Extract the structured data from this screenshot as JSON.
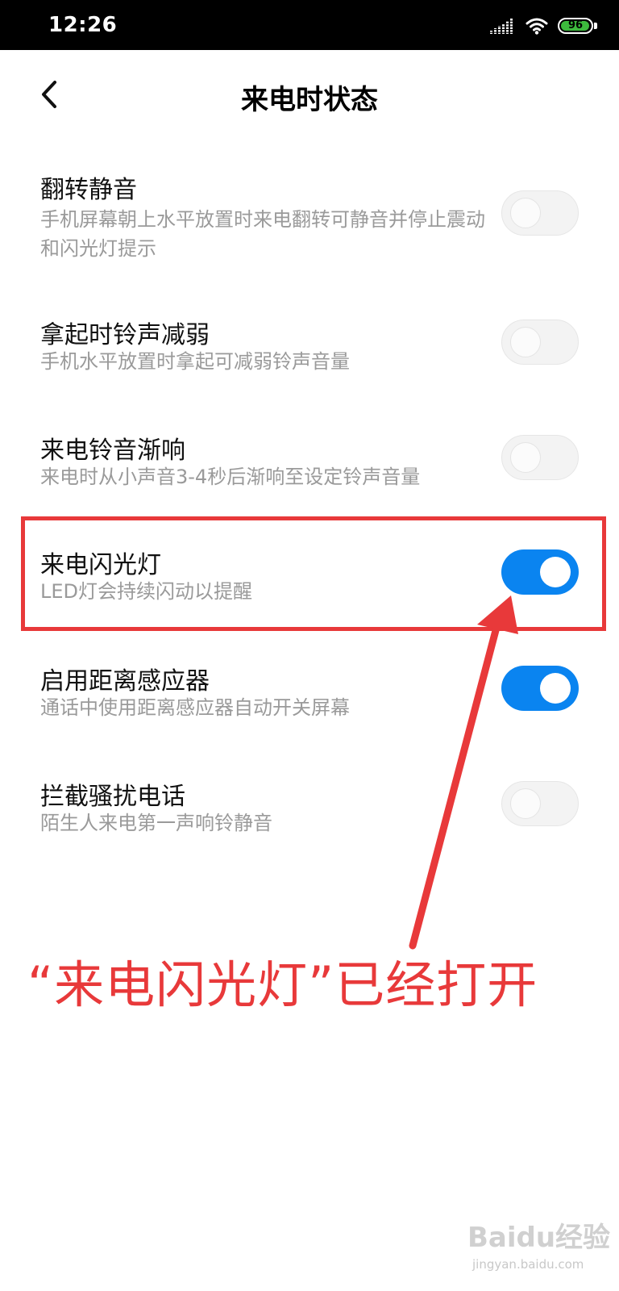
{
  "status_bar": {
    "time": "12:26",
    "signal_icon": "cellular-signal-icon",
    "wifi_icon": "wifi-icon",
    "battery_level": "96",
    "battery_color": "#3dba3d"
  },
  "header": {
    "back_icon": "chevron-left-icon",
    "title": "来电时状态"
  },
  "settings": [
    {
      "title": "翻转静音",
      "description": "手机屏幕朝上水平放置时来电翻转可静音并停止震动和闪光灯提示",
      "enabled": false
    },
    {
      "title": "拿起时铃声减弱",
      "description": "手机水平放置时拿起可减弱铃声音量",
      "enabled": false
    },
    {
      "title": "来电铃音渐响",
      "description": "来电时从小声音3-4秒后渐响至设定铃声音量",
      "enabled": false
    },
    {
      "title": "来电闪光灯",
      "description": "LED灯会持续闪动以提醒",
      "enabled": true
    },
    {
      "title": "启用距离感应器",
      "description": "通话中使用距离感应器自动开关屏幕",
      "enabled": true
    },
    {
      "title": "拦截骚扰电话",
      "description": "陌生人来电第一声响铃静音",
      "enabled": false
    }
  ],
  "colors": {
    "toggle_on": "#0a84f0",
    "annotation": "#e8393a"
  },
  "annotation": {
    "text": "“来电闪光灯”已经打开"
  },
  "watermark": {
    "logo": "Baidu经验",
    "url": "jingyan.baidu.com"
  }
}
